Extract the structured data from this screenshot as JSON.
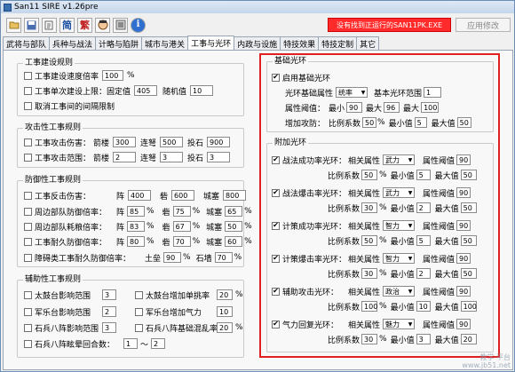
{
  "title": "San11 SIRE v1.26pre",
  "toolbar": {
    "simp": "简",
    "trad": "繁",
    "info": "i"
  },
  "warning": "没有找到正运行的SAN11PK.EXE",
  "apply": "应用修改",
  "tabs": [
    "武将与部队",
    "兵种与战法",
    "计略与陷阱",
    "城市与港关",
    "工事与光环",
    "内政与设施",
    "特技效果",
    "特技定制",
    "其它"
  ],
  "build": {
    "title": "工事建设规则",
    "speed": "工事建设速度倍率",
    "speed_val": "100",
    "pct": "%",
    "single": "工事单次建设上限：",
    "fixed": "固定值",
    "fixed_val": "405",
    "rand": "随机值",
    "rand_val": "10",
    "cancel": "取消工事间的间隔限制"
  },
  "attack": {
    "title": "攻击性工事规则",
    "r1": "工事攻击伤害：",
    "r2": "工事攻击范围：",
    "arrow": "箭楼",
    "heavy": "连弩",
    "stone": "投石",
    "d1": [
      "300",
      "500",
      "900"
    ],
    "d2": [
      "2",
      "3",
      "3"
    ]
  },
  "defense": {
    "title": "防御性工事规则",
    "r1": "工事反击伤害：",
    "r2": "周边部队防御倍率：",
    "r3": "周边部队耗粮倍率：",
    "r4": "工事耐久防御倍率：",
    "r5": "障碍类工事耐久防御倍率：",
    "l1": "阵",
    "l2": "砦",
    "l3": "城塞",
    "r1v": [
      "400",
      "600",
      "800"
    ],
    "r2v": [
      "85",
      "75",
      "65"
    ],
    "r3v": [
      "83",
      "67",
      "50"
    ],
    "r4v": [
      "80",
      "70",
      "60"
    ],
    "earth": "土垒",
    "earth_val": "90",
    "stonewall": "石墙",
    "stonewall_val": "70",
    "pct": "%"
  },
  "aux": {
    "title": "辅助性工事规则",
    "a1": "太鼓台影响范围",
    "a1v": "3",
    "a2": "太鼓台增加单挑率",
    "a2v": "20",
    "a3": "军乐台影响范围",
    "a3v": "2",
    "a4": "军乐台增加气力",
    "a4v": "10",
    "a5": "石兵八阵影响范围",
    "a5v": "3",
    "a6": "石兵八阵基础混乱率",
    "a6v": "20",
    "a7": "石兵八阵眩晕回合数：",
    "a7v1": "1",
    "tilde": "～",
    "a7v2": "2",
    "pct": "%"
  },
  "aura": {
    "title": "基础光环",
    "enable": "启用基础光环",
    "attr_label": "光环基础属性",
    "attr": "统率",
    "range_label": "基本光环范围",
    "range_val": "1",
    "thr_label": "属性阈值：",
    "t1": "最小",
    "t1v": "90",
    "t2": "最大",
    "t2v": "96",
    "t3": "最大",
    "t3v": "100",
    "atk_label": "增加攻防：",
    "ratio": "比例系数",
    "ratio_v": "50",
    "min": "最小值",
    "min_v": "5",
    "max": "最大值",
    "max_v": "50"
  },
  "extra": {
    "title": "附加光环",
    "rel": "相关属性",
    "thr": "属性阈值",
    "ratio": "比例系数",
    "min": "最小值",
    "max": "最大值",
    "pct": "%",
    "items": [
      {
        "name": "战法成功率光环：",
        "attr": "武力",
        "thr": "90",
        "ratio": "50",
        "min": "5",
        "max": "50"
      },
      {
        "name": "战法爆击率光环：",
        "attr": "武力",
        "thr": "90",
        "ratio": "30",
        "min": "2",
        "max": "50"
      },
      {
        "name": "计策成功率光环：",
        "attr": "智力",
        "thr": "90",
        "ratio": "50",
        "min": "5",
        "max": "50"
      },
      {
        "name": "计策爆击率光环：",
        "attr": "智力",
        "thr": "90",
        "ratio": "30",
        "min": "2",
        "max": "50"
      },
      {
        "name": "辅助攻击光环：",
        "attr": "政治",
        "thr": "90",
        "ratio": "100",
        "min": "10",
        "max": "100"
      },
      {
        "name": "气力回复光环：",
        "attr": "魅力",
        "thr": "90",
        "ratio": "30",
        "min": "3",
        "max": "20"
      }
    ]
  },
  "watermark1": "教学·平台",
  "watermark2": "www.jb51.net"
}
